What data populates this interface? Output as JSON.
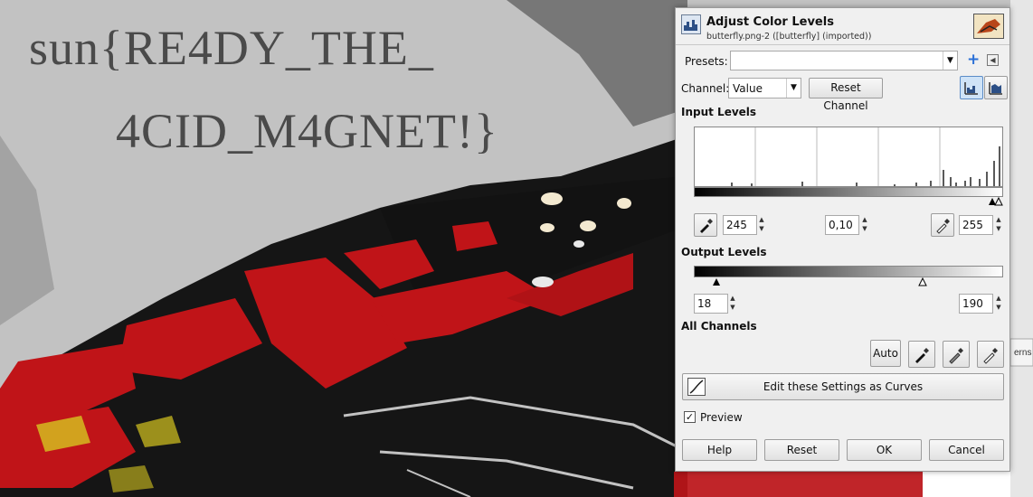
{
  "canvas": {
    "flag_line1": "sun{RE4DY_THE_",
    "flag_line2": "4CID_M4GNET!}",
    "right_tab_fragment": "erns"
  },
  "dialog": {
    "title": "Adjust Color Levels",
    "subtitle": "butterfly.png-2 ([butterfly] (imported))",
    "presets_label": "Presets:",
    "presets_value": "",
    "channel_label": "Channel:",
    "channel_value": "Value",
    "reset_channel_label": "Reset Channel",
    "input_levels_heading": "Input Levels",
    "input_low": "245",
    "input_gamma": "0,10",
    "input_high": "255",
    "output_levels_heading": "Output Levels",
    "output_low": "18",
    "output_high": "190",
    "all_channels_heading": "All Channels",
    "auto_label": "Auto",
    "edit_curves_label": "Edit these Settings as Curves",
    "preview_label": "Preview",
    "preview_checked": true,
    "buttons": {
      "help": "Help",
      "reset": "Reset",
      "ok": "OK",
      "cancel": "Cancel"
    }
  },
  "colors": {
    "wing_red": "#c01418",
    "black": "#151515",
    "bg_gray": "#c2c2c2",
    "accent_blue": "#2a6fd6"
  }
}
